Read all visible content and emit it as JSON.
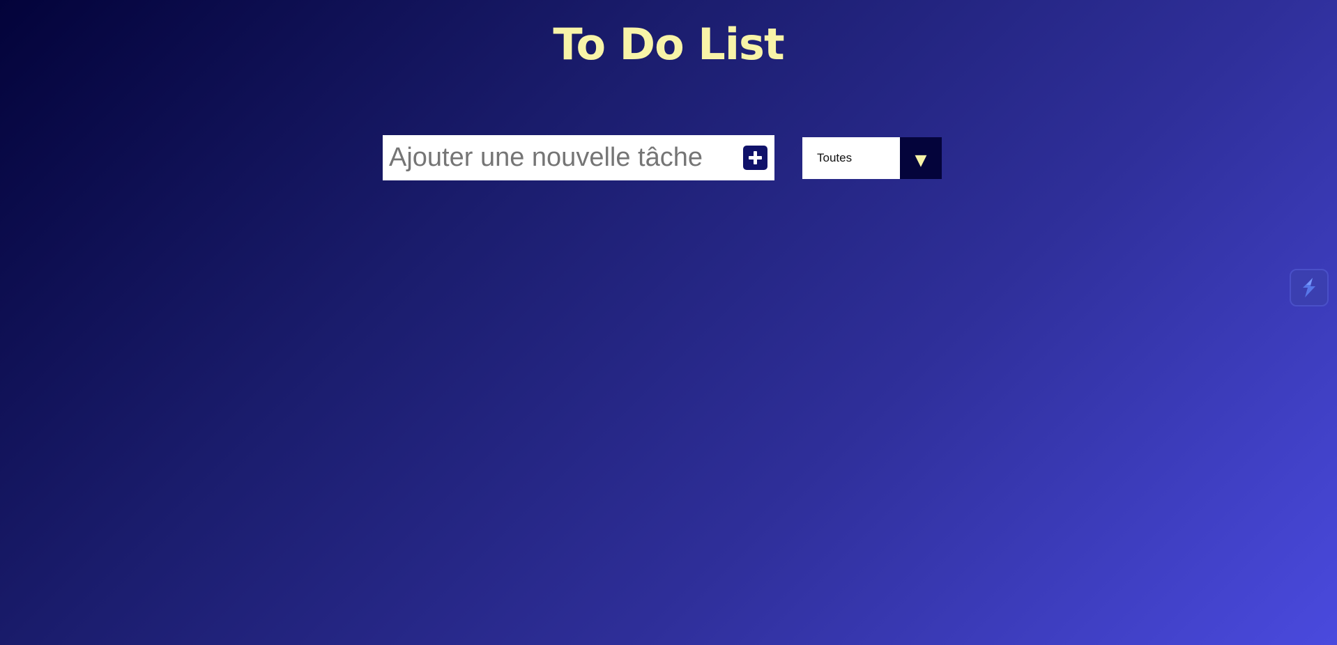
{
  "header": {
    "title": "To Do List"
  },
  "add_task": {
    "placeholder": "Ajouter une nouvelle tâche",
    "value": "",
    "button_icon": "plus-icon"
  },
  "filter": {
    "selected": "Toutes",
    "arrow": "▼"
  },
  "extension": {
    "icon": "lightning-icon"
  },
  "colors": {
    "title": "#f8f4a8",
    "background_start": "#03033a",
    "background_end": "#4a4ade",
    "accent": "#10126a",
    "filter_arrow_bg": "#04043b"
  }
}
